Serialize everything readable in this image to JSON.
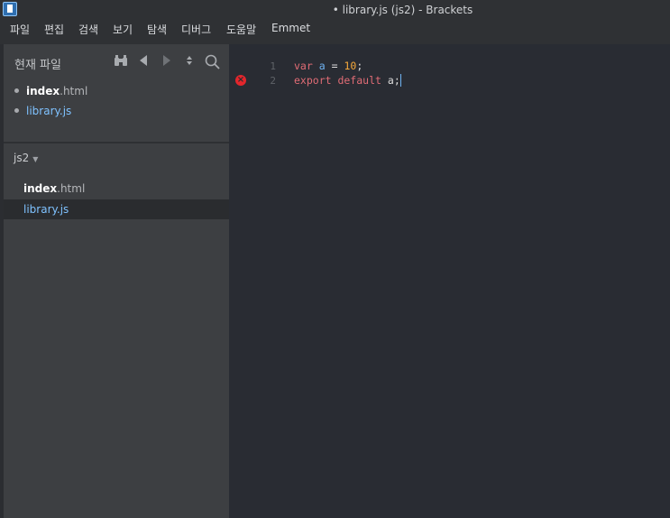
{
  "window": {
    "title": "• library.js (js2) - Brackets"
  },
  "menu": [
    "파일",
    "편집",
    "검색",
    "보기",
    "탐색",
    "디버그",
    "도움말",
    "Emmet"
  ],
  "working_files": {
    "header": "현재 파일",
    "items": [
      {
        "name": "index",
        "ext": ".html"
      },
      {
        "name": "library.js",
        "ext": ""
      }
    ]
  },
  "project": {
    "name": "js2",
    "files": [
      {
        "name": "index",
        "ext": ".html"
      },
      {
        "name": "library.js",
        "ext": ""
      }
    ]
  },
  "editor": {
    "line_numbers": [
      "1",
      "2"
    ],
    "lines": [
      {
        "kw": "var",
        "ident": "a",
        "op": "=",
        "num": "10",
        "end": ";"
      },
      {
        "kw": "export default",
        "ident": "a",
        "end": ";"
      }
    ],
    "error_line": "2"
  },
  "icons": {
    "binoculars": "binoculars-icon",
    "prev": "triangle-left-icon",
    "next": "triangle-right-icon",
    "split": "up-down-arrows-icon",
    "search": "search-icon",
    "error": "error-icon"
  },
  "colors": {
    "keyword": "#e06c75",
    "variable": "#6fb3f2",
    "number": "#f6a93b",
    "error": "#e3262c",
    "active_file": "#7fc2ff"
  }
}
